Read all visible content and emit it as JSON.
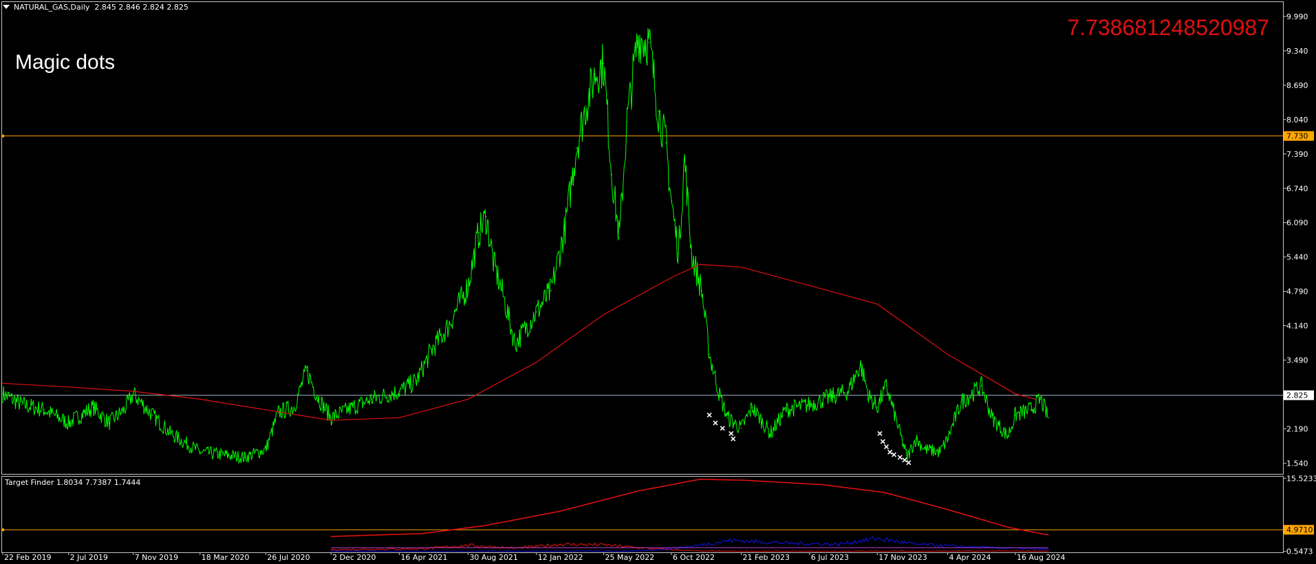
{
  "header": {
    "symbol_info": "NATURAL_GAS,Daily  2.845 2.846 2.824 2.825"
  },
  "overlay": {
    "label": "Magic dots",
    "value": "7.738681248520987"
  },
  "indicator": {
    "title": "Target Finder 1.8034 7.7387 1.7444"
  },
  "colors": {
    "background": "#000000",
    "price": "#00ff00",
    "moving_average": "#e01010",
    "hline": "#ffa500",
    "current_price_line": "#a0b4c8",
    "ind_red": "#e01010",
    "ind_blue": "#1010e0",
    "ind_purple": "#b040d0",
    "markers": "#ffffff"
  },
  "chart_data": [
    {
      "type": "line",
      "title": "NATURAL_GAS,Daily",
      "x_tick_labels": [
        "22 Feb 2019",
        "2 Jul 2019",
        "7 Nov 2019",
        "18 Mar 2020",
        "26 Jul 2020",
        "2 Dec 2020",
        "16 Apr 2021",
        "30 Aug 2021",
        "12 Jan 2022",
        "25 May 2022",
        "6 Oct 2022",
        "21 Feb 2023",
        "6 Jul 2023",
        "17 Nov 2023",
        "4 Apr 2024",
        "16 Aug 2024"
      ],
      "y_tick_labels": [
        "9.990",
        "9.340",
        "8.690",
        "8.040",
        "7.390",
        "6.740",
        "6.090",
        "5.440",
        "4.790",
        "4.140",
        "3.490",
        "2.190",
        "1.540"
      ],
      "ylim": [
        1.35,
        10.25
      ],
      "hline_value": 7.73,
      "hline_label": "7.730",
      "current_price": 2.825,
      "current_price_label": "2.825",
      "series": [
        {
          "kind": "price",
          "x": [
            "2019-02-22",
            "2019-04-01",
            "2019-05-15",
            "2019-07-02",
            "2019-08-20",
            "2019-09-20",
            "2019-10-20",
            "2019-11-07",
            "2019-12-15",
            "2020-01-20",
            "2020-03-18",
            "2020-05-01",
            "2020-06-15",
            "2020-07-26",
            "2020-08-20",
            "2020-09-20",
            "2020-10-15",
            "2020-11-05",
            "2020-12-02",
            "2021-01-15",
            "2021-02-20",
            "2021-04-16",
            "2021-05-20",
            "2021-06-20",
            "2021-07-20",
            "2021-08-30",
            "2021-09-20",
            "2021-10-05",
            "2021-10-20",
            "2021-11-05",
            "2021-12-01",
            "2022-01-12",
            "2022-02-10",
            "2022-03-10",
            "2022-04-01",
            "2022-04-20",
            "2022-05-08",
            "2022-05-25",
            "2022-06-10",
            "2022-06-25",
            "2022-07-10",
            "2022-08-01",
            "2022-08-23",
            "2022-09-10",
            "2022-09-25",
            "2022-10-06",
            "2022-10-20",
            "2022-11-01",
            "2022-11-15",
            "2022-12-05",
            "2022-12-20",
            "2023-01-10",
            "2023-01-25",
            "2023-02-21",
            "2023-03-15",
            "2023-04-20",
            "2023-05-20",
            "2023-07-06",
            "2023-08-20",
            "2023-09-20",
            "2023-10-15",
            "2023-11-01",
            "2023-11-17",
            "2023-12-05",
            "2024-01-01",
            "2024-01-15",
            "2024-02-01",
            "2024-02-20",
            "2024-03-20",
            "2024-04-04",
            "2024-05-01",
            "2024-06-10",
            "2024-07-01",
            "2024-08-01",
            "2024-08-16",
            "2024-09-15",
            "2024-10-05",
            "2024-10-20"
          ],
          "y": [
            2.85,
            2.65,
            2.55,
            2.3,
            2.6,
            2.3,
            2.55,
            2.85,
            2.45,
            2.1,
            1.75,
            1.7,
            1.65,
            1.8,
            2.5,
            2.6,
            3.3,
            2.8,
            2.4,
            2.6,
            2.75,
            2.9,
            3.1,
            3.7,
            4.1,
            4.9,
            5.9,
            6.2,
            5.3,
            4.8,
            3.8,
            4.4,
            4.8,
            6.0,
            7.5,
            8.3,
            8.9,
            9.1,
            7.0,
            5.8,
            8.0,
            9.6,
            9.5,
            8.2,
            7.6,
            6.5,
            5.5,
            7.3,
            5.5,
            4.8,
            3.6,
            2.8,
            2.4,
            2.2,
            2.6,
            2.1,
            2.55,
            2.65,
            2.8,
            2.9,
            3.4,
            2.8,
            2.6,
            3.0,
            2.1,
            1.65,
            2.0,
            1.8,
            1.75,
            2.0,
            2.7,
            3.0,
            2.4,
            2.05,
            2.45,
            2.55,
            2.75,
            2.4
          ]
        },
        {
          "kind": "moving_average",
          "x": [
            "2019-02-22",
            "2019-07-02",
            "2019-11-07",
            "2020-03-18",
            "2020-07-26",
            "2020-12-02",
            "2021-04-16",
            "2021-08-30",
            "2022-01-12",
            "2022-05-25",
            "2022-10-06",
            "2022-12-01",
            "2023-02-21",
            "2023-07-06",
            "2023-11-17",
            "2024-04-04",
            "2024-08-16",
            "2024-09-25"
          ],
          "y": [
            3.05,
            2.98,
            2.9,
            2.75,
            2.55,
            2.35,
            2.4,
            2.75,
            3.45,
            4.35,
            5.05,
            5.3,
            5.25,
            4.9,
            4.55,
            3.6,
            2.85,
            2.75
          ]
        },
        {
          "kind": "markers",
          "x": [
            "2022-12-20",
            "2023-01-01",
            "2023-01-15",
            "2023-02-01",
            "2023-02-05",
            "2023-11-22",
            "2023-11-28",
            "2023-12-05",
            "2023-12-12",
            "2023-12-20",
            "2024-01-01",
            "2024-01-10",
            "2024-01-18"
          ],
          "y": [
            2.45,
            2.3,
            2.2,
            2.1,
            2.0,
            2.1,
            1.95,
            1.85,
            1.75,
            1.7,
            1.65,
            1.6,
            1.55
          ]
        }
      ]
    },
    {
      "type": "line",
      "title": "Target Finder",
      "y_tick_labels": [
        "15.5233",
        "4.9710",
        "0.5473"
      ],
      "ylim": [
        0.5,
        15.7
      ],
      "hline_value": 4.971,
      "hline_label": "4.9710",
      "series": [
        {
          "kind": "upper",
          "x": [
            "2020-12-02",
            "2021-06-01",
            "2021-10-01",
            "2022-03-01",
            "2022-08-01",
            "2022-12-01",
            "2023-03-01",
            "2023-08-01",
            "2023-12-01",
            "2024-04-01",
            "2024-08-01",
            "2024-10-20"
          ],
          "y": [
            3.6,
            4.2,
            5.8,
            8.8,
            12.9,
            15.3,
            15.1,
            14.2,
            12.6,
            9.2,
            5.5,
            3.9
          ]
        },
        {
          "kind": "lower_red",
          "x": [
            "2020-12-02",
            "2021-06-01",
            "2021-09-01",
            "2021-12-01",
            "2022-03-01",
            "2022-05-25",
            "2022-08-01",
            "2022-10-06",
            "2022-12-01",
            "2023-06-01",
            "2024-01-01",
            "2024-06-01",
            "2024-10-20"
          ],
          "y": [
            0.9,
            1.1,
            1.8,
            1.2,
            2.0,
            1.9,
            1.3,
            0.9,
            0.6,
            0.55,
            0.6,
            0.6,
            0.6
          ]
        },
        {
          "kind": "lower_blue",
          "x": [
            "2020-12-02",
            "2021-06-01",
            "2022-01-01",
            "2022-08-01",
            "2022-11-01",
            "2023-02-01",
            "2023-06-01",
            "2023-09-01",
            "2023-11-17",
            "2024-02-01",
            "2024-06-01",
            "2024-10-20"
          ],
          "y": [
            0.6,
            0.55,
            0.6,
            0.6,
            1.4,
            2.8,
            2.2,
            2.0,
            3.2,
            2.0,
            1.4,
            1.0
          ]
        }
      ]
    }
  ]
}
